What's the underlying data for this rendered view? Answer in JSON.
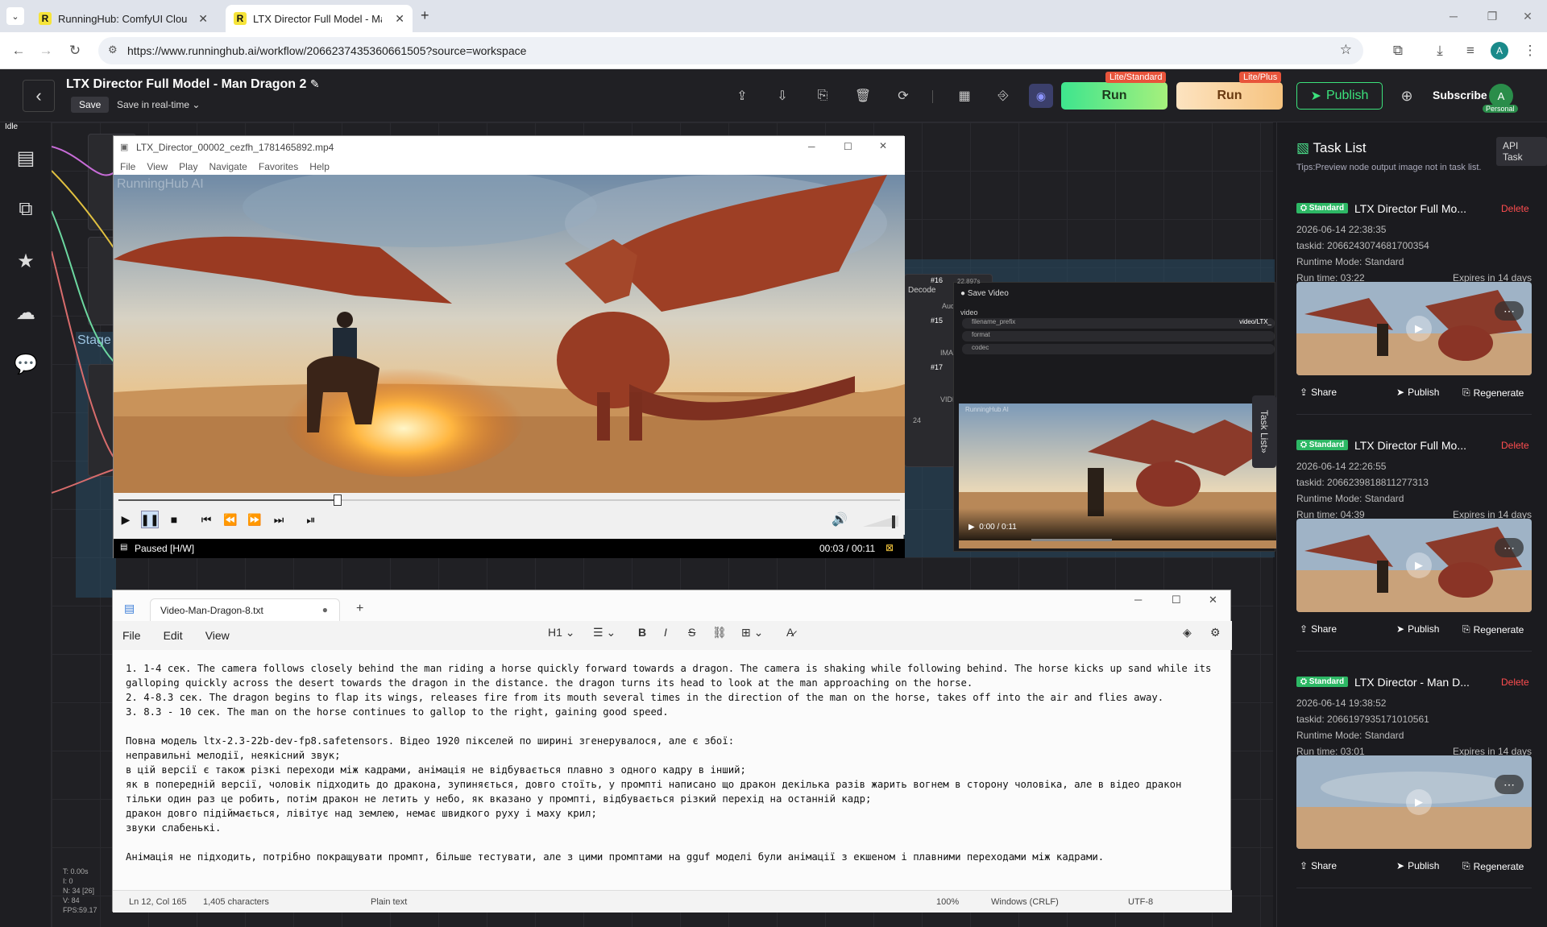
{
  "browser": {
    "tabs": [
      {
        "title": "RunningHub: ComfyUI Cloud, C",
        "active": false
      },
      {
        "title": "LTX Director Full Model - Man D",
        "active": true
      }
    ],
    "url": "https://www.runninghub.ai/workflow/2066237435360661505?source=workspace",
    "profile_initial": "A"
  },
  "app": {
    "workflow_title": "LTX Director Full Model - Man Dragon 2",
    "save_label": "Save",
    "save_mode": "Save in real-time",
    "run_standard_label": "Run",
    "run_standard_badge": "Lite/Standard",
    "run_plus_label": "Run",
    "run_plus_badge": "Lite/Plus",
    "publish_label": "Publish",
    "subscribe_label": "Subscribe",
    "avatar_initial": "A",
    "avatar_tag": "Personal",
    "status": "Idle",
    "colors": {
      "accent_green": "#3ce27c",
      "run_standard": "#4be08a",
      "run_plus": "#f7c98a",
      "delete": "#ff4d4f"
    }
  },
  "canvas": {
    "stats": [
      "T: 0.00s",
      "I: 0",
      "N: 34 [26]",
      "V: 84",
      "FPS:59.17"
    ],
    "group_label": "Stage",
    "node_labels": [
      "#16",
      "#15",
      "#17",
      "Decode",
      "Audio",
      "IMAGE",
      "VIDEO",
      "24",
      "Save Video",
      "video",
      "filename_prefix",
      "video/LTX_",
      "format",
      "codec",
      "22.897s"
    ],
    "save_video_time": "0:00 / 0:11",
    "watermark": "RunningHub AI"
  },
  "player": {
    "title": "LTX_Director_00002_cezfh_1781465892.mp4",
    "menu": [
      "File",
      "View",
      "Play",
      "Navigate",
      "Favorites",
      "Help"
    ],
    "status": "Paused [H/W]",
    "time": "00:03 / 00:11",
    "progress": 0.28,
    "watermark": "RunningHub AI"
  },
  "tasklist": {
    "title": "Task List",
    "api_label": "API Task",
    "tips": "Tips:Preview node output image not in task list.",
    "side_tab": "Task List",
    "badge_label": "Standard",
    "share_label": "Share",
    "publish_label": "Publish",
    "regenerate_label": "Regenerate",
    "delete_label": "Delete",
    "tasks": [
      {
        "title": "LTX Director Full Mo...",
        "date": "2026-06-14 22:38:35",
        "taskid": "taskid: 2066243074681700354",
        "mode": "Runtime Mode: Standard",
        "runtime": "Run time: 03:22",
        "expires": "Expires in 14 days"
      },
      {
        "title": "LTX Director Full Mo...",
        "date": "2026-06-14 22:26:55",
        "taskid": "taskid: 2066239818811277313",
        "mode": "Runtime Mode: Standard",
        "runtime": "Run time: 04:39",
        "expires": "Expires in 14 days"
      },
      {
        "title": "LTX Director - Man D...",
        "date": "2026-06-14 19:38:52",
        "taskid": "taskid: 2066197935171010561",
        "mode": "Runtime Mode: Standard",
        "runtime": "Run time: 03:01",
        "expires": "Expires in 14 days"
      }
    ]
  },
  "notepad": {
    "tab_title": "Video-Man-Dragon-8.txt",
    "menu": [
      "File",
      "Edit",
      "View"
    ],
    "heading_label": "H1",
    "text": "1. 1-4 сек. The camera follows closely behind the man riding a horse quickly forward towards a dragon. The camera is shaking while following behind. The horse kicks up sand while its galloping quickly across the desert towards the dragon in the distance. the dragon turns its head to look at the man approaching on the horse.\n2. 4-8.3 сек. The dragon begins to flap its wings, releases fire from its mouth several times in the direction of the man on the horse, takes off into the air and flies away.\n3. 8.3 - 10 сек. The man on the horse continues to gallop to the right, gaining good speed.\n\nПовна модель ltx-2.3-22b-dev-fp8.safetensors. Відео 1920 пікселей по ширині згенерувалося, але є збої:\nнеправильні мелодії, неякісний звук;\nв цій версії є також різкі переходи між кадрами, анімація не відбувається плавно з одного кадру в інший;\nяк в попередній версії, чоловік підходить до дракона, зупиняється, довго стоїть, у промпті написано що дракон декілька разів жарить вогнем в сторону чоловіка, але в відео дракон тільки один раз це робить, потім дракон не летить у небо, як вказано у промпті, відбувається різкий перехід на останній кадр;\nдракон довго підіймається, лівітує над землею, немає швидкого руху і маху крил;\nзвуки слабенькі.\n\nАнімація не підходить, потрібно покращувати промпт, більше тестувати, але з цими промптами на gguf моделі були анімації з екшеном і плавними переходами між кадрами.",
    "status": {
      "position": "Ln 12, Col 165",
      "chars": "1,405 characters",
      "format": "Plain text",
      "zoom": "100%",
      "eol": "Windows (CRLF)",
      "encoding": "UTF-8"
    }
  }
}
